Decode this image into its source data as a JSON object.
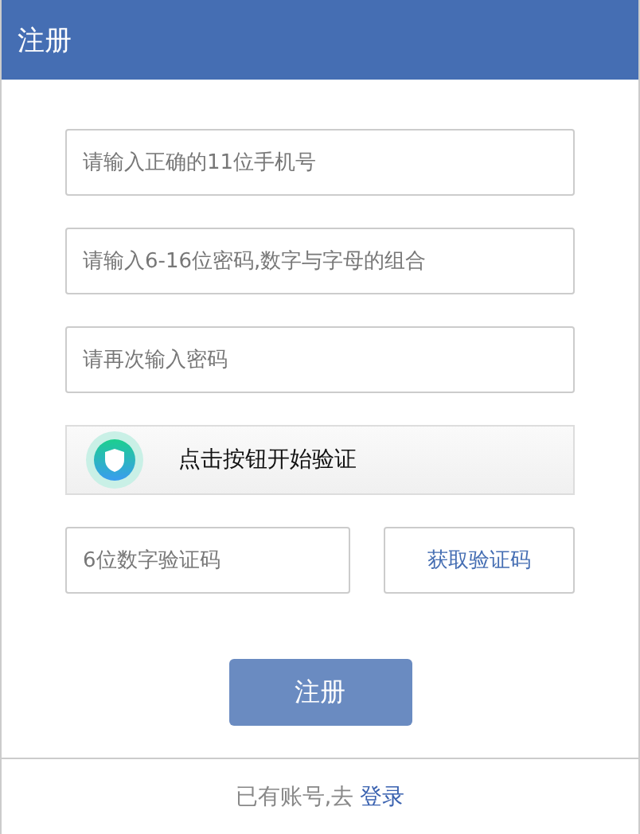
{
  "header": {
    "title": "注册"
  },
  "fields": [
    {
      "placeholder": "请输入正确的11位手机号"
    },
    {
      "placeholder": "请输入6-16位密码,数字与字母的组合"
    },
    {
      "placeholder": "请再次输入密码"
    }
  ],
  "verify": {
    "label": "点击按钮开始验证"
  },
  "code": {
    "placeholder": "6位数字验证码",
    "button": "获取验证码"
  },
  "submit": "注册",
  "footer": {
    "text": "已有账号,去",
    "link": "登录"
  }
}
